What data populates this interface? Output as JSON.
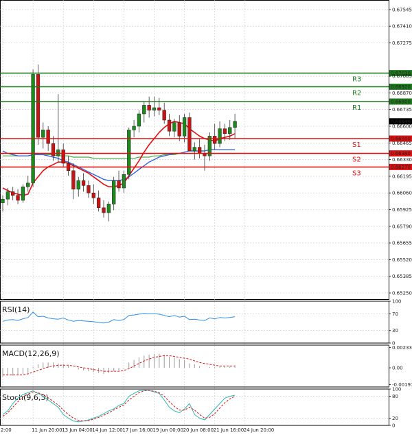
{
  "chart_data": {
    "type": "candlestick",
    "price_axis": {
      "ticks": [
        "0.67545",
        "0.67410",
        "0.67275",
        "0.67005",
        "0.66870",
        "0.66735",
        "0.66600",
        "0.66465",
        "0.66330",
        "0.66195",
        "0.66060",
        "0.65925",
        "0.65790",
        "0.65655",
        "0.65520",
        "0.65385",
        "0.65250"
      ],
      "tick_values": [
        0.67545,
        0.6741,
        0.67275,
        0.67005,
        0.6687,
        0.66735,
        0.666,
        0.66465,
        0.6633,
        0.66195,
        0.6606,
        0.65925,
        0.6579,
        0.65655,
        0.6552,
        0.65385,
        0.6525
      ],
      "range": [
        0.652,
        0.676
      ]
    },
    "time_axis": {
      "labels": [
        "2:00",
        "11 Jun 20:00",
        "13 Jun 04:00",
        "14 Jun 12:00",
        "17 Jun 16:00",
        "19 Jun 00:00",
        "20 Jun 08:00",
        "21 Jun 16:00",
        "24 Jun 20:00"
      ],
      "label_index": [
        0,
        6,
        12,
        18,
        24,
        30,
        36,
        42,
        48
      ]
    },
    "levels": [
      {
        "name": "R3",
        "value": 0.6703,
        "label": "0.67030",
        "color": "#1e7a1e"
      },
      {
        "name": "R2",
        "value": 0.6692,
        "label": "0.66920",
        "color": "#1e7a1e"
      },
      {
        "name": "R1",
        "value": 0.668,
        "label": "0.66800",
        "color": "#1e7a1e"
      },
      {
        "name": "S1",
        "value": 0.665,
        "label": "0.66500",
        "color": "#dd1111"
      },
      {
        "name": "S2",
        "value": 0.6638,
        "label": "0.66380",
        "color": "#dd1111"
      },
      {
        "name": "S3",
        "value": 0.6627,
        "label": "0.66270",
        "color": "#dd1111"
      }
    ],
    "current_price": {
      "value": 0.6664,
      "label": "0.66640"
    },
    "candles": [
      [
        0.6598,
        0.6604,
        0.6591,
        0.6601
      ],
      [
        0.6601,
        0.661,
        0.6596,
        0.6607
      ],
      [
        0.6607,
        0.6611,
        0.66,
        0.6604
      ],
      [
        0.6604,
        0.6609,
        0.6597,
        0.66
      ],
      [
        0.66,
        0.6613,
        0.6598,
        0.6611
      ],
      [
        0.6611,
        0.662,
        0.6607,
        0.6614
      ],
      [
        0.6614,
        0.6706,
        0.6611,
        0.6702
      ],
      [
        0.6702,
        0.671,
        0.6645,
        0.6651
      ],
      [
        0.6651,
        0.6663,
        0.6642,
        0.6657
      ],
      [
        0.6657,
        0.666,
        0.664,
        0.6646
      ],
      [
        0.6646,
        0.6652,
        0.6632,
        0.6636
      ],
      [
        0.6636,
        0.6686,
        0.6631,
        0.6641
      ],
      [
        0.6641,
        0.6646,
        0.6627,
        0.663
      ],
      [
        0.663,
        0.6636,
        0.662,
        0.6624
      ],
      [
        0.6624,
        0.663,
        0.6601,
        0.6609
      ],
      [
        0.6609,
        0.6619,
        0.6603,
        0.6616
      ],
      [
        0.6616,
        0.6622,
        0.6607,
        0.6612
      ],
      [
        0.6612,
        0.6616,
        0.6602,
        0.6606
      ],
      [
        0.6606,
        0.6613,
        0.6597,
        0.6602
      ],
      [
        0.6602,
        0.6608,
        0.6591,
        0.6594
      ],
      [
        0.6594,
        0.66,
        0.6586,
        0.659
      ],
      [
        0.659,
        0.6599,
        0.6583,
        0.6597
      ],
      [
        0.6597,
        0.6619,
        0.6592,
        0.6616
      ],
      [
        0.6616,
        0.6624,
        0.6607,
        0.661
      ],
      [
        0.661,
        0.6624,
        0.6606,
        0.6621
      ],
      [
        0.6621,
        0.6659,
        0.6617,
        0.6657
      ],
      [
        0.6657,
        0.6665,
        0.6651,
        0.666
      ],
      [
        0.666,
        0.6673,
        0.6655,
        0.667
      ],
      [
        0.667,
        0.668,
        0.6663,
        0.6677
      ],
      [
        0.6677,
        0.6684,
        0.6667,
        0.6673
      ],
      [
        0.6673,
        0.6684,
        0.6668,
        0.6675
      ],
      [
        0.6675,
        0.6683,
        0.6669,
        0.6673
      ],
      [
        0.6673,
        0.6679,
        0.6662,
        0.6665
      ],
      [
        0.6665,
        0.667,
        0.6652,
        0.6656
      ],
      [
        0.6656,
        0.6666,
        0.6651,
        0.6663
      ],
      [
        0.6663,
        0.6669,
        0.6648,
        0.6652
      ],
      [
        0.6652,
        0.667,
        0.6647,
        0.6667
      ],
      [
        0.6667,
        0.6671,
        0.664,
        0.664
      ],
      [
        0.664,
        0.6647,
        0.6633,
        0.6643
      ],
      [
        0.6643,
        0.665,
        0.6634,
        0.6638
      ],
      [
        0.6638,
        0.6645,
        0.6624,
        0.6636
      ],
      [
        0.6636,
        0.6655,
        0.6632,
        0.6652
      ],
      [
        0.6652,
        0.6662,
        0.6641,
        0.6646
      ],
      [
        0.6646,
        0.6664,
        0.6643,
        0.6658
      ],
      [
        0.6658,
        0.6662,
        0.6648,
        0.6654
      ],
      [
        0.6654,
        0.6665,
        0.6649,
        0.6659
      ],
      [
        0.6659,
        0.667,
        0.665,
        0.6664
      ]
    ],
    "indicators": {
      "rsi": {
        "label": "RSI(14)",
        "ticks": [
          "100",
          "70",
          "30",
          "0"
        ],
        "tick_values": [
          100,
          70,
          30,
          0
        ],
        "values": [
          52,
          55,
          56,
          54,
          58,
          61,
          74,
          63,
          64,
          60,
          58,
          57,
          60,
          55,
          52,
          54,
          53,
          52,
          51,
          49,
          48,
          50,
          56,
          54,
          56,
          66,
          67,
          69,
          71,
          70,
          70,
          69,
          66,
          63,
          66,
          62,
          64,
          56,
          57,
          55,
          54,
          60,
          58,
          61,
          60,
          61,
          63
        ]
      },
      "macd": {
        "label": "MACD(12,26,9)",
        "ticks": [
          "0.002332",
          "0.00",
          "-0.001911"
        ],
        "tick_values": [
          0.002332,
          0,
          -0.001911
        ],
        "hist": [
          -0.001,
          -0.0009,
          -0.0009,
          -0.0008,
          -0.0007,
          -0.0006,
          0.0001,
          0.0004,
          0.0006,
          0.0006,
          0.0006,
          0.0005,
          0.0004,
          0.0002,
          0.0,
          -0.0002,
          -0.0003,
          -0.0004,
          -0.0005,
          -0.0006,
          -0.0007,
          -0.0006,
          -0.0004,
          -0.0003,
          -0.0001,
          0.0006,
          0.0009,
          0.0012,
          0.0014,
          0.0015,
          0.0016,
          0.0016,
          0.0015,
          0.0013,
          0.0012,
          0.001,
          0.0009,
          0.0005,
          0.0004,
          0.0002,
          0.0,
          0.0001,
          0.0001,
          0.0002,
          0.0002,
          0.0002,
          0.0003
        ],
        "signal": [
          -0.0008,
          -0.0008,
          -0.0008,
          -0.0008,
          -0.0008,
          -0.0007,
          -0.0005,
          -0.0003,
          -0.0001,
          0.0001,
          0.0002,
          0.0003,
          0.0003,
          0.0003,
          0.0002,
          0.0001,
          0.0,
          -0.0001,
          -0.0002,
          -0.0003,
          -0.0004,
          -0.0004,
          -0.0004,
          -0.0004,
          -0.0003,
          -0.0001,
          0.0002,
          0.0005,
          0.0008,
          0.001,
          0.0012,
          0.0013,
          0.0014,
          0.0014,
          0.0013,
          0.0012,
          0.0011,
          0.001,
          0.0008,
          0.0006,
          0.0005,
          0.0004,
          0.0003,
          0.0002,
          0.0002,
          0.0002,
          0.0002
        ]
      },
      "stoch": {
        "label": "Stoch(9,6,3)",
        "ticks": [
          "100",
          "80",
          "20",
          "0"
        ],
        "tick_values": [
          100,
          80,
          20,
          0
        ],
        "k": [
          30,
          40,
          60,
          75,
          85,
          90,
          95,
          88,
          80,
          70,
          60,
          50,
          30,
          20,
          12,
          10,
          12,
          15,
          20,
          25,
          32,
          40,
          45,
          55,
          60,
          80,
          88,
          95,
          97,
          96,
          92,
          88,
          70,
          50,
          40,
          35,
          45,
          60,
          30,
          20,
          15,
          30,
          45,
          60,
          75,
          80,
          83
        ],
        "d": [
          25,
          35,
          50,
          65,
          78,
          86,
          92,
          90,
          84,
          76,
          66,
          56,
          42,
          30,
          20,
          14,
          12,
          13,
          17,
          22,
          28,
          35,
          42,
          50,
          56,
          70,
          80,
          90,
          95,
          96,
          94,
          90,
          80,
          65,
          52,
          42,
          42,
          50,
          42,
          30,
          20,
          22,
          32,
          48,
          62,
          73,
          80
        ]
      }
    },
    "moving_averages": {
      "red": [
        0.661,
        0.6608,
        0.6606,
        0.6605,
        0.6604,
        0.6605,
        0.6614,
        0.6619,
        0.6624,
        0.6627,
        0.6629,
        0.6631,
        0.6631,
        0.663,
        0.6628,
        0.6626,
        0.6624,
        0.6622,
        0.6619,
        0.6616,
        0.6613,
        0.6611,
        0.6611,
        0.6612,
        0.6614,
        0.662,
        0.6626,
        0.6632,
        0.6639,
        0.6645,
        0.665,
        0.6655,
        0.6659,
        0.6662,
        0.6664,
        0.6663,
        0.6662,
        0.6658,
        0.6655,
        0.6652,
        0.665,
        0.6649,
        0.6648,
        0.665,
        0.6651,
        0.6652,
        0.6654
      ],
      "blue": [
        0.664,
        0.6638,
        0.6637,
        0.6636,
        0.6636,
        0.6636,
        0.6637,
        0.6637,
        0.6637,
        0.6636,
        0.6635,
        0.6634,
        0.6632,
        0.6631,
        0.6629,
        0.6627,
        0.6625,
        0.6623,
        0.6621,
        0.6619,
        0.6617,
        0.6616,
        0.6616,
        0.6616,
        0.6617,
        0.6619,
        0.6622,
        0.6625,
        0.6628,
        0.6631,
        0.6633,
        0.6635,
        0.6636,
        0.6637,
        0.6638,
        0.6638,
        0.6639,
        0.664,
        0.664,
        0.664,
        0.664,
        0.6641,
        0.6641,
        0.6641,
        0.6641,
        0.6641,
        0.6641
      ],
      "green": [
        0.6636,
        0.6636,
        0.6636,
        0.6636,
        0.6636,
        0.6636,
        0.6637,
        0.6637,
        0.6637,
        0.6637,
        0.6637,
        0.6636,
        0.6636,
        0.6636,
        0.6635,
        0.6635,
        0.6635,
        0.6635,
        0.6634,
        0.6634,
        0.6634,
        0.6634,
        0.6634,
        0.6634,
        0.6634,
        0.6634,
        0.6634,
        0.6635,
        0.6635,
        0.6635,
        0.6636,
        0.6636,
        0.6637,
        0.6637,
        0.6637,
        0.6638,
        0.6638,
        0.6638,
        0.6638,
        0.6638,
        0.6638,
        0.6638,
        0.6638,
        0.6638,
        0.6638,
        0.6638,
        0.6638
      ]
    },
    "colors": {
      "up": "#1e8a1e",
      "down": "#c81414",
      "wick": "#333333",
      "rsi_line": "#2e8fe6",
      "macd_hist": "#9a9a9a",
      "macd_signal": "#dd1111",
      "stoch_k": "#2bb5b0",
      "stoch_d": "#dd1111",
      "ma_red": "#e01010",
      "ma_blue": "#3366dd",
      "ma_green": "#44aa44"
    }
  }
}
